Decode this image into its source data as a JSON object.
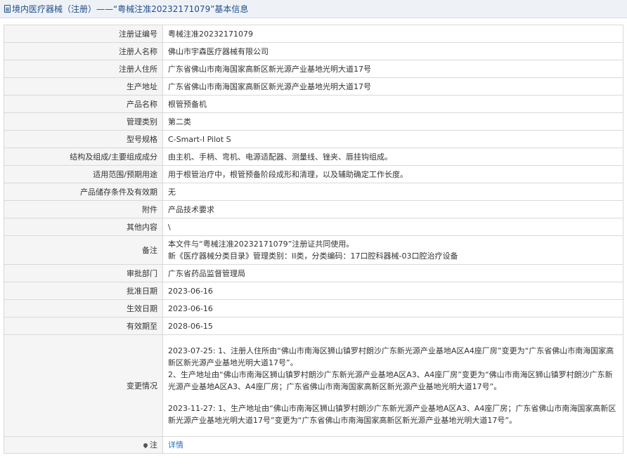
{
  "header": {
    "title": "境内医疗器械（注册）——“粤械注准20232171079”基本信息"
  },
  "rows": [
    {
      "label": "注册证编号",
      "value": "粤械注准20232171079"
    },
    {
      "label": "注册人名称",
      "value": "佛山市宇森医疗器械有限公司"
    },
    {
      "label": "注册人住所",
      "value": "广东省佛山市南海国家高新区新光源产业基地光明大道17号"
    },
    {
      "label": "生产地址",
      "value": "广东省佛山市南海国家高新区新光源产业基地光明大道17号"
    },
    {
      "label": "产品名称",
      "value": "根管预备机"
    },
    {
      "label": "管理类别",
      "value": "第二类"
    },
    {
      "label": "型号规格",
      "value": "C-Smart-I Pilot S"
    },
    {
      "label": "结构及组成/主要组成成分",
      "value": "由主机、手柄、弯机、电源适配器、测量线、锉夹、唇挂钩组成。"
    },
    {
      "label": "适用范围/预期用途",
      "value": "用于根管治疗中，根管预备阶段成形和清理，以及辅助确定工作长度。"
    },
    {
      "label": "产品储存条件及有效期",
      "value": "无"
    },
    {
      "label": "附件",
      "value": "产品技术要求"
    },
    {
      "label": "其他内容",
      "value": "\\"
    }
  ],
  "remark": {
    "label": "备注",
    "line1": "本文件与“粤械注准20232171079”注册证共同使用。",
    "line2": "新《医疗器械分类目录》管理类别：II类，分类编码：17口腔科器械-03口腔治疗设备"
  },
  "rows2": [
    {
      "label": "审批部门",
      "value": "广东省药品监督管理局"
    },
    {
      "label": "批准日期",
      "value": "2023-06-16"
    },
    {
      "label": "生效日期",
      "value": "2023-06-16"
    },
    {
      "label": "有效期至",
      "value": "2028-06-15"
    }
  ],
  "changes": {
    "label": "变更情况",
    "entry1": "2023-07-25: 1、注册人住所由“佛山市南海区狮山镇罗村朗沙广东新光源产业基地A区A4座厂房”变更为“广东省佛山市南海国家高新区新光源产业基地光明大道17号”。",
    "entry1b": "2、生产地址由“佛山市南海区狮山镇罗村朗沙广东新光源产业基地A区A3、A4座厂房”变更为“佛山市南海区狮山镇罗村朗沙广东新光源产业基地A区A3、A4座厂房；广东省佛山市南海国家高新区新光源产业基地光明大道17号”。",
    "entry2": "2023-11-27: 1、生产地址由“佛山市南海区狮山镇罗村朗沙广东新光源产业基地A区A3、A4座厂房；广东省佛山市南海国家高新区新光源产业基地光明大道17号”变更为“广东省佛山市南海国家高新区新光源产业基地光明大道17号”。"
  },
  "note": {
    "label": "注",
    "link": "详情",
    "icon": "pin-icon"
  },
  "colors": {
    "title_text": "#1f4e8c",
    "link": "#2a6ebb",
    "label_bg": "#f5f5f5",
    "border": "#d9d9d9"
  }
}
